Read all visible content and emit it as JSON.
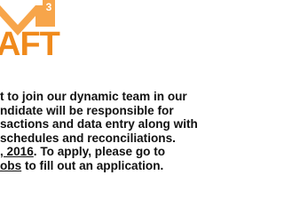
{
  "logo": {
    "text": "AFT",
    "badge_number": "3",
    "text_color": "#f08a1c",
    "accent_color": "#f7a54a",
    "icon": "logo-chevron"
  },
  "paragraph1": {
    "lines": [
      "t to join our dynamic team in our",
      "ndidate will be responsible for",
      "sactions and data entry along with",
      "schedules and reconciliations."
    ]
  },
  "paragraph2": {
    "line1_link": ", 2016",
    "line1_text": ". To apply, please go to",
    "line2_link": "obs",
    "line2_text": " to fill out an application."
  }
}
